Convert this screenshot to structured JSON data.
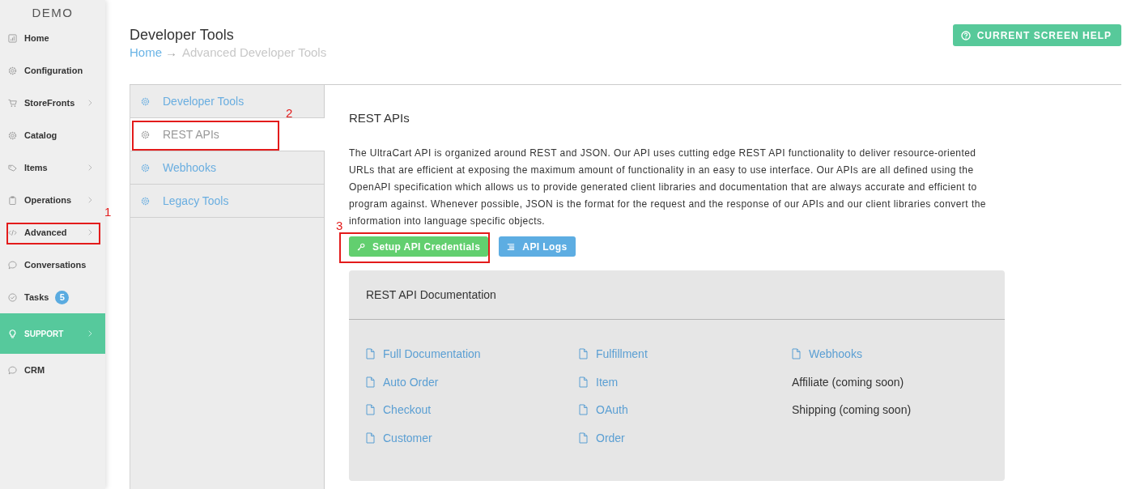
{
  "sidebar": {
    "brand": "DEMO",
    "items": [
      {
        "label": "Home",
        "kind": "nav",
        "has_submenu": false
      },
      {
        "label": "Configuration",
        "kind": "nav",
        "has_submenu": false
      },
      {
        "label": "StoreFronts",
        "kind": "nav",
        "has_submenu": true
      },
      {
        "label": "Catalog",
        "kind": "nav",
        "has_submenu": false
      },
      {
        "label": "Items",
        "kind": "nav",
        "has_submenu": true
      },
      {
        "label": "Operations",
        "kind": "nav",
        "has_submenu": true
      },
      {
        "label": "Advanced",
        "kind": "nav",
        "has_submenu": true,
        "callout": "1"
      },
      {
        "label": "Conversations",
        "kind": "nav",
        "has_submenu": false
      },
      {
        "label": "Tasks",
        "kind": "nav",
        "has_submenu": false,
        "badge": "5"
      },
      {
        "label": "SUPPORT",
        "kind": "accent",
        "has_submenu": true
      },
      {
        "label": "CRM",
        "kind": "nav",
        "has_submenu": false
      }
    ]
  },
  "header": {
    "title": "Developer Tools",
    "breadcrumb": [
      {
        "label": "Home",
        "kind": "link"
      },
      {
        "label": "Advanced Developer Tools",
        "kind": "current"
      }
    ],
    "separator": "→",
    "help_button": "CURRENT SCREEN HELP"
  },
  "tabs": [
    {
      "label": "Developer Tools",
      "selected": false
    },
    {
      "label": "REST APIs",
      "selected": true,
      "callout": "2"
    },
    {
      "label": "Webhooks",
      "selected": false
    },
    {
      "label": "Legacy Tools",
      "selected": false
    }
  ],
  "content": {
    "heading": "REST APIs",
    "description": "The UltraCart API is organized around REST and JSON. Our API uses cutting edge REST API functionality to deliver resource-oriented URLs that are efficient at exposing the maximum amount of functionality in an easy to use interface. Our APIs are all defined using the OpenAPI specification which allows us to provide generated client libraries and documentation that are always accurate and efficient to program against. Whenever possible, JSON is the format for the request and the response of our APIs and our client libraries convert the information into language specific objects.",
    "buttons": [
      {
        "label": "Setup API Credentials",
        "kind": "success",
        "callout": "3"
      },
      {
        "label": "API Logs",
        "kind": "info"
      }
    ],
    "docs": {
      "title": "REST API Documentation",
      "columns": [
        [
          {
            "label": "Full Documentation",
            "kind": "link"
          },
          {
            "label": "Auto Order",
            "kind": "link"
          },
          {
            "label": "Checkout",
            "kind": "link"
          },
          {
            "label": "Customer",
            "kind": "link"
          }
        ],
        [
          {
            "label": "Fulfillment",
            "kind": "link"
          },
          {
            "label": "Item",
            "kind": "link"
          },
          {
            "label": "OAuth",
            "kind": "link"
          },
          {
            "label": "Order",
            "kind": "link"
          }
        ],
        [
          {
            "label": "Webhooks",
            "kind": "link"
          },
          {
            "label": "Affiliate (coming soon)",
            "kind": "text"
          },
          {
            "label": "Shipping (coming soon)",
            "kind": "text"
          }
        ]
      ]
    }
  }
}
